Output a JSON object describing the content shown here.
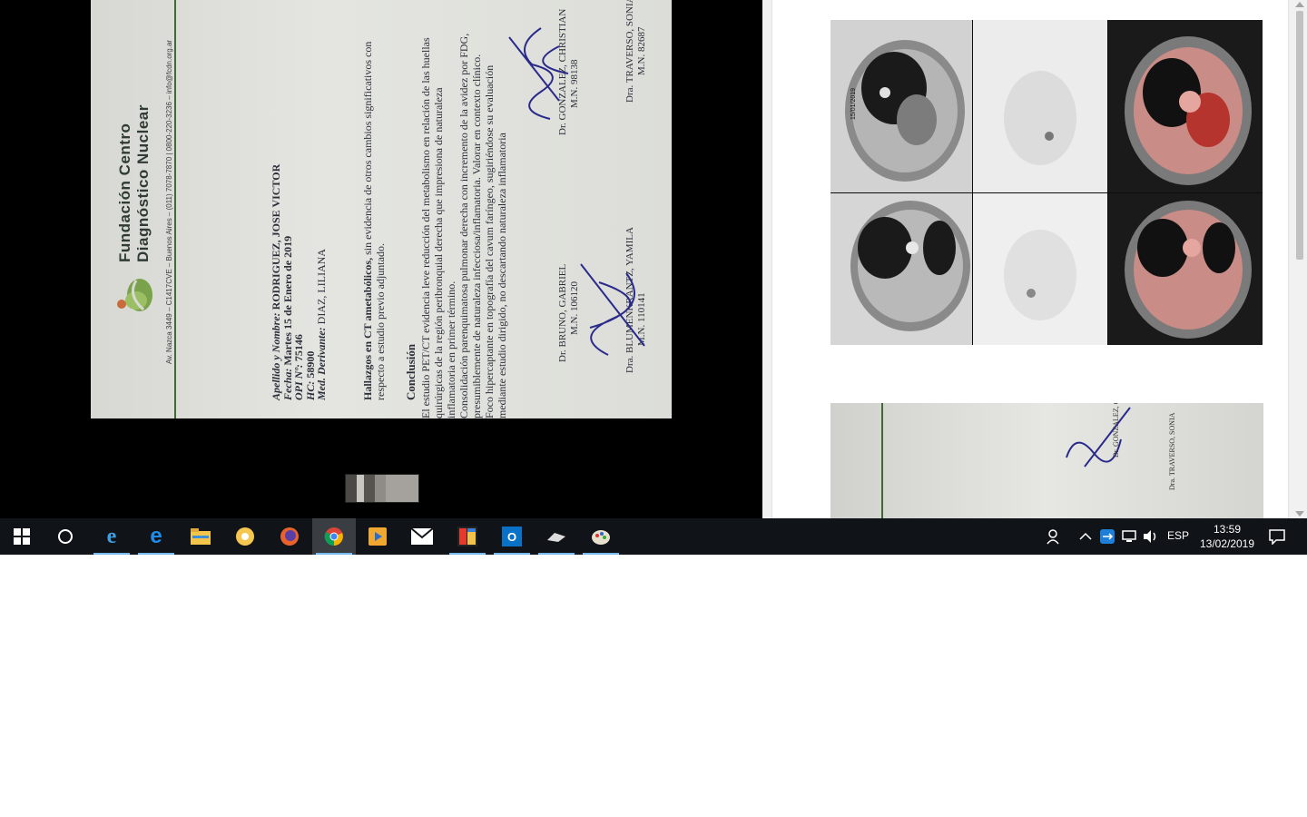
{
  "document": {
    "brand_line1": "Fundación Centro",
    "brand_line2": "Diagnóstico Nuclear",
    "address": "Av. Nazca 3449 – C1417CVE – Buenos Aires – (011) 7078-7870 | 0800-220-3236 – info@fcdn.org.ar",
    "patient": {
      "name_label": "Apellido y Nombre:",
      "name_value": "RODRIGUEZ, JOSE VICTOR",
      "date_label": "Fecha:",
      "date_value": "Martes 15 de Enero de 2019",
      "opi_label": "OPI Nº:",
      "opi_value": "75146",
      "hc_label": "HC:",
      "hc_value": "58900",
      "med_label": "Med. Derivante:",
      "med_value": "DIAZ, LILIANA"
    },
    "findings_bold": "Hallazgos en CT ametabólicos,",
    "findings_text": " sin evidencia de otros cambios significativos con respecto a estudio previo adjuntado.",
    "conclusion_title": "Conclusión",
    "conclusion_lines": [
      "El estudio PET/CT evidencia leve reducción del metabolismo en relación de las huellas",
      "quirúrgicas de la región peribronquial derecha que impresiona de naturaleza",
      "inflamatoria en primer término.",
      "Consolidación parenquimatosa pulmonar derecha con incremento de la avidez por FDG,",
      "presumiblemente de naturaleza infecciosa/inflamatoria. Valorar en contexto clínico.",
      "Foco hipercaptante en topografía del cavum faríngeo, sugiriéndose su evaluación",
      "mediante estudio dirigido, no descartando naturaleza inflamatoria"
    ],
    "signatures": [
      {
        "name": "Dr. GONZALEZ, CHRISTIAN",
        "mn": "M.N. 98138"
      },
      {
        "name": "Dra. TRAVERSO, SONIA",
        "mn": "M.N. 82687"
      },
      {
        "name": "Dr. BRUNO, GABRIEL",
        "mn": "M.N. 106120"
      },
      {
        "name": "Dra. BLUMENKRANTZ, YAMILA",
        "mn": "M.N. 110141"
      }
    ]
  },
  "scan_labels": {
    "date_stamp": "15/01/2019"
  },
  "taskbar": {
    "apps": [
      {
        "name": "start-button",
        "icon": "windows-icon"
      },
      {
        "name": "cortana-button",
        "icon": "cortana-icon"
      },
      {
        "name": "internet-explorer",
        "icon": "ie-icon"
      },
      {
        "name": "edge",
        "icon": "edge-icon"
      },
      {
        "name": "file-explorer",
        "icon": "folder-icon"
      },
      {
        "name": "picasa",
        "icon": "picasa-icon"
      },
      {
        "name": "firefox",
        "icon": "firefox-icon"
      },
      {
        "name": "chrome",
        "icon": "chrome-icon"
      },
      {
        "name": "media-player",
        "icon": "media-icon"
      },
      {
        "name": "mail",
        "icon": "mail-icon"
      },
      {
        "name": "photo-app",
        "icon": "photo-icon"
      },
      {
        "name": "outlook",
        "icon": "outlook-icon"
      },
      {
        "name": "scanner-app",
        "icon": "scanner-icon"
      },
      {
        "name": "paint-app",
        "icon": "paint-icon"
      }
    ],
    "language": "ESP",
    "time": "13:59",
    "date": "13/02/2019"
  }
}
